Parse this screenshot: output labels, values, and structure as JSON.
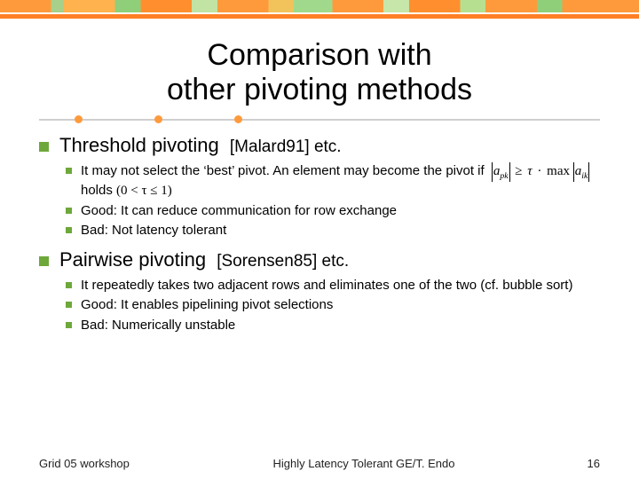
{
  "title_line1": "Comparison with",
  "title_line2": "other pivoting methods",
  "sections": [
    {
      "heading": "Threshold pivoting",
      "ref": "[Malard91] etc.",
      "items": [
        {
          "pre": "It may not select the ‘best’ pivot. An element may become the pivot if ",
          "mid": " holds  ",
          "math1_lhs_base": "a",
          "math1_lhs_sub": "pk",
          "math1_ge": "≥",
          "math1_tau": "τ",
          "math1_dot": "·",
          "math1_max": "max",
          "math1_rhs_base": "a",
          "math1_rhs_sub": "ik",
          "math2": "(0 < τ ≤ 1)"
        },
        {
          "text": "Good: It can reduce communication for row exchange"
        },
        {
          "text": "Bad: Not latency tolerant"
        }
      ]
    },
    {
      "heading": "Pairwise pivoting",
      "ref": "[Sorensen85] etc.",
      "items": [
        {
          "text": "It repeatedly takes two adjacent rows and eliminates one of the two (cf. bubble sort)"
        },
        {
          "text": "Good: It enables pipelining pivot selections"
        },
        {
          "text": "Bad: Numerically unstable"
        }
      ]
    }
  ],
  "footer": {
    "left": "Grid 05 workshop",
    "mid": "Highly Latency Tolerant GE/T. Endo",
    "right": "16"
  }
}
